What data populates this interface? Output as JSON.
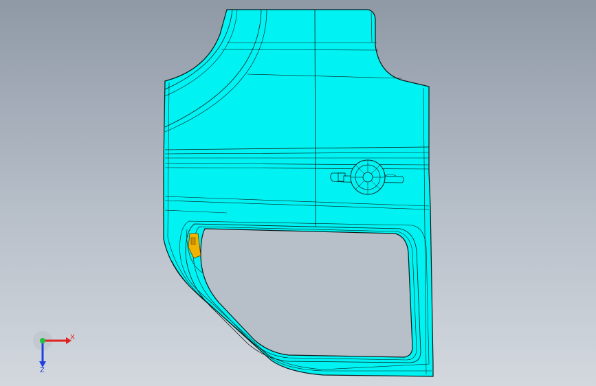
{
  "viewport": {
    "background_top": "#8f99a6",
    "background_bottom": "#d3d8de"
  },
  "model": {
    "body_color": "#00f2f2",
    "edge_color": "#0b1a1a",
    "window_color": "#b7bfc9",
    "hinge_color": "#f0b400"
  },
  "triad": {
    "x_label": "X",
    "z_label": "Z",
    "x_color": "#e02020",
    "y_color": "#20c040",
    "z_color": "#2040e0"
  }
}
